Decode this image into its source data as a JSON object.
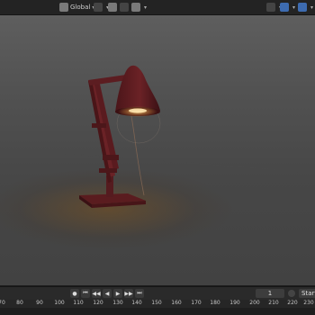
{
  "header": {
    "transform_orientation": "Global"
  },
  "viewport": {
    "object": "desk lamp"
  },
  "timeline": {
    "current_frame": "1",
    "start_label": "Start",
    "ruler_ticks": [
      "70",
      "80",
      "90",
      "100",
      "110",
      "120",
      "130",
      "140",
      "150",
      "160",
      "170",
      "180",
      "190",
      "200",
      "210",
      "220",
      "230"
    ]
  },
  "colors": {
    "lamp": "#6b2226",
    "lamp_dark": "#3e1216",
    "bulb_glow": "#ffcf7a",
    "accent": "#3d6bb0"
  }
}
